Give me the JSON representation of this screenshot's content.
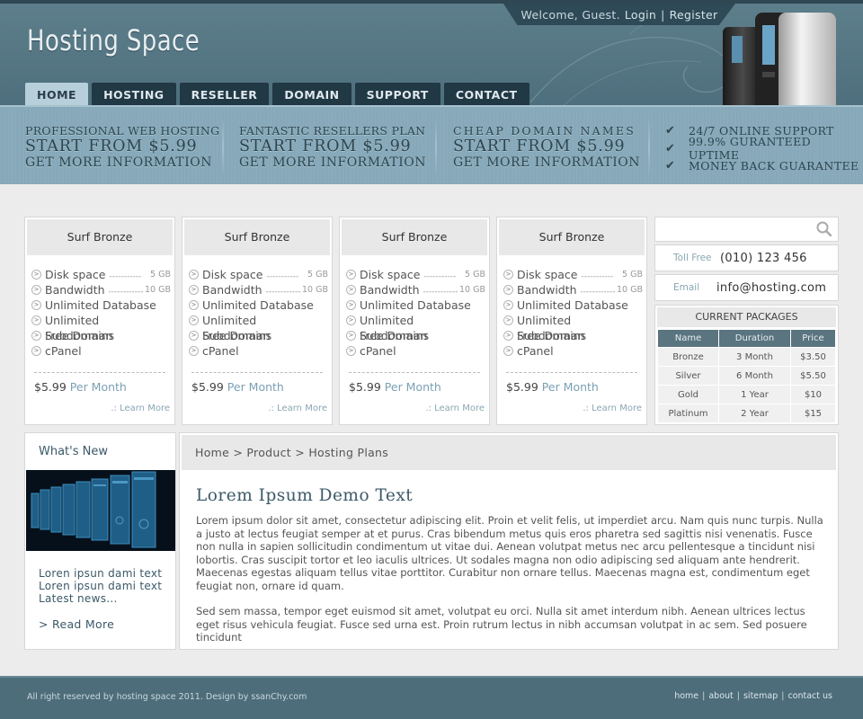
{
  "header": {
    "welcome_text": "Welcome, Guest.",
    "login_label": "Login",
    "separator": "|",
    "register_label": "Register",
    "logo_text": "Hosting Space"
  },
  "nav": {
    "items": [
      {
        "label": "HOME",
        "active": true
      },
      {
        "label": "HOSTING"
      },
      {
        "label": "RESELLER"
      },
      {
        "label": "DOMAIN"
      },
      {
        "label": "SUPPORT"
      },
      {
        "label": "CONTACT"
      }
    ]
  },
  "promos": [
    {
      "line1": "PROFESSIONAL WEB HOSTING",
      "line2": "START FROM $5.99",
      "line3": "GET MORE INFORMATION"
    },
    {
      "line1": "FANTASTIC RESELLERS PLAN",
      "line2": "START FROM $5.99",
      "line3": "GET MORE INFORMATION"
    },
    {
      "line1": "CHEAP DOMAIN NAMES",
      "line2": "START FROM $5.99",
      "line3": "GET MORE INFORMATION"
    }
  ],
  "features": [
    "24/7 ONLINE SUPPORT",
    "99.9% GURANTEED UPTIME",
    "MONEY BACK GUARANTEE"
  ],
  "cards": [
    {
      "title": "Surf Bronze",
      "disk_label": "Disk space",
      "disk_dash": "-----------",
      "disk_amount": "5 GB",
      "bw_label": "Bandwidth",
      "bw_dash": "------------",
      "bw_amount": "10 GB",
      "f3": "Unlimited Database",
      "f4": "Unlimited Subdomains",
      "f5": "Free Doman",
      "f6": "cPanel",
      "price": "$5.99",
      "per": "Per Month",
      "learn_more": ".: Learn More"
    },
    {
      "title": "Surf Bronze",
      "disk_label": "Disk space",
      "disk_dash": "-----------",
      "disk_amount": "5 GB",
      "bw_label": "Bandwidth",
      "bw_dash": "------------",
      "bw_amount": "10 GB",
      "f3": "Unlimited Database",
      "f4": "Unlimited Subdomains",
      "f5": "Free Doman",
      "f6": "cPanel",
      "price": "$5.99",
      "per": "Per Month",
      "learn_more": ".: Learn More"
    },
    {
      "title": "Surf Bronze",
      "disk_label": "Disk space",
      "disk_dash": "-----------",
      "disk_amount": "5 GB",
      "bw_label": "Bandwidth",
      "bw_dash": "------------",
      "bw_amount": "10 GB",
      "f3": "Unlimited Database",
      "f4": "Unlimited Subdomains",
      "f5": "Free Doman",
      "f6": "cPanel",
      "price": "$5.99",
      "per": "Per Month",
      "learn_more": ".: Learn More"
    },
    {
      "title": "Surf Bronze",
      "disk_label": "Disk space",
      "disk_dash": "-----------",
      "disk_amount": "5 GB",
      "bw_label": "Bandwidth",
      "bw_dash": "------------",
      "bw_amount": "10 GB",
      "f3": "Unlimited Database",
      "f4": "Unlimited Subdomains",
      "f5": "Free Doman",
      "f6": "cPanel",
      "price": "$5.99",
      "per": "Per Month",
      "learn_more": ".: Learn More"
    }
  ],
  "search": {
    "value": "",
    "placeholder": ""
  },
  "contact": {
    "tollfree_label": "Toll Free",
    "tollfree_value": "(010) 123 456",
    "email_label": "Email",
    "email_value": "info@hosting.com"
  },
  "packages": {
    "title": "CURRENT PACKAGES",
    "headers": [
      "Name",
      "Duration",
      "Price"
    ],
    "rows": [
      [
        "Bronze",
        "3 Month",
        "$3.50"
      ],
      [
        "Silver",
        "6 Month",
        "$5.50"
      ],
      [
        "Gold",
        "1 Year",
        "$10"
      ],
      [
        "Platinum",
        "2 Year",
        "$15"
      ]
    ]
  },
  "news": {
    "title": "What's New",
    "line1": "Loren ipsun dami text",
    "line2": "Loren ipsun dami text",
    "line3": "Latest news...",
    "read_more": "> Read More"
  },
  "main": {
    "breadcrumb": "Home > Product > Hosting Plans",
    "heading": "Lorem Ipsum Demo Text",
    "para1": "Lorem ipsum dolor sit amet, consectetur adipiscing elit. Proin et velit felis, ut imperdiet arcu. Nam quis nunc turpis. Nulla a justo at lectus feugiat semper at et purus. Cras bibendum metus quis eros pharetra sed sagittis nisi venenatis. Fusce non nulla in sapien sollicitudin condimentum ut vitae dui. Aenean volutpat metus nec arcu pellentesque a tincidunt nisi lobortis. Cras suscipit tortor et leo iaculis ultrices. Ut sodales magna non odio adipiscing sed aliquam ante hendrerit. Maecenas egestas aliquam tellus vitae porttitor. Curabitur non ornare tellus. Maecenas magna est, condimentum eget feugiat non, ornare id quam.",
    "para2": "Sed sem massa, tempor eget euismod sit amet, volutpat eu orci. Nulla sit amet interdum nibh. Aenean ultrices lectus eget risus vehicula feugiat. Fusce sed urna est. Proin rutrum lectus in nibh accumsan volutpat in ac sem. Sed posuere tincidunt"
  },
  "footer": {
    "copyright": "All right reserved by hosting space 2011. Design by ssanChy.com",
    "links": [
      "home",
      "about",
      "sitemap",
      "contact us"
    ],
    "separator": "|"
  },
  "colors": {
    "header_bg": "#567784",
    "nav_tab": "#213845",
    "nav_active": "#b7cfda",
    "promo_bg": "#86a8b8",
    "accent_text": "#3b5968",
    "footer_bg": "#4e6d7a"
  }
}
